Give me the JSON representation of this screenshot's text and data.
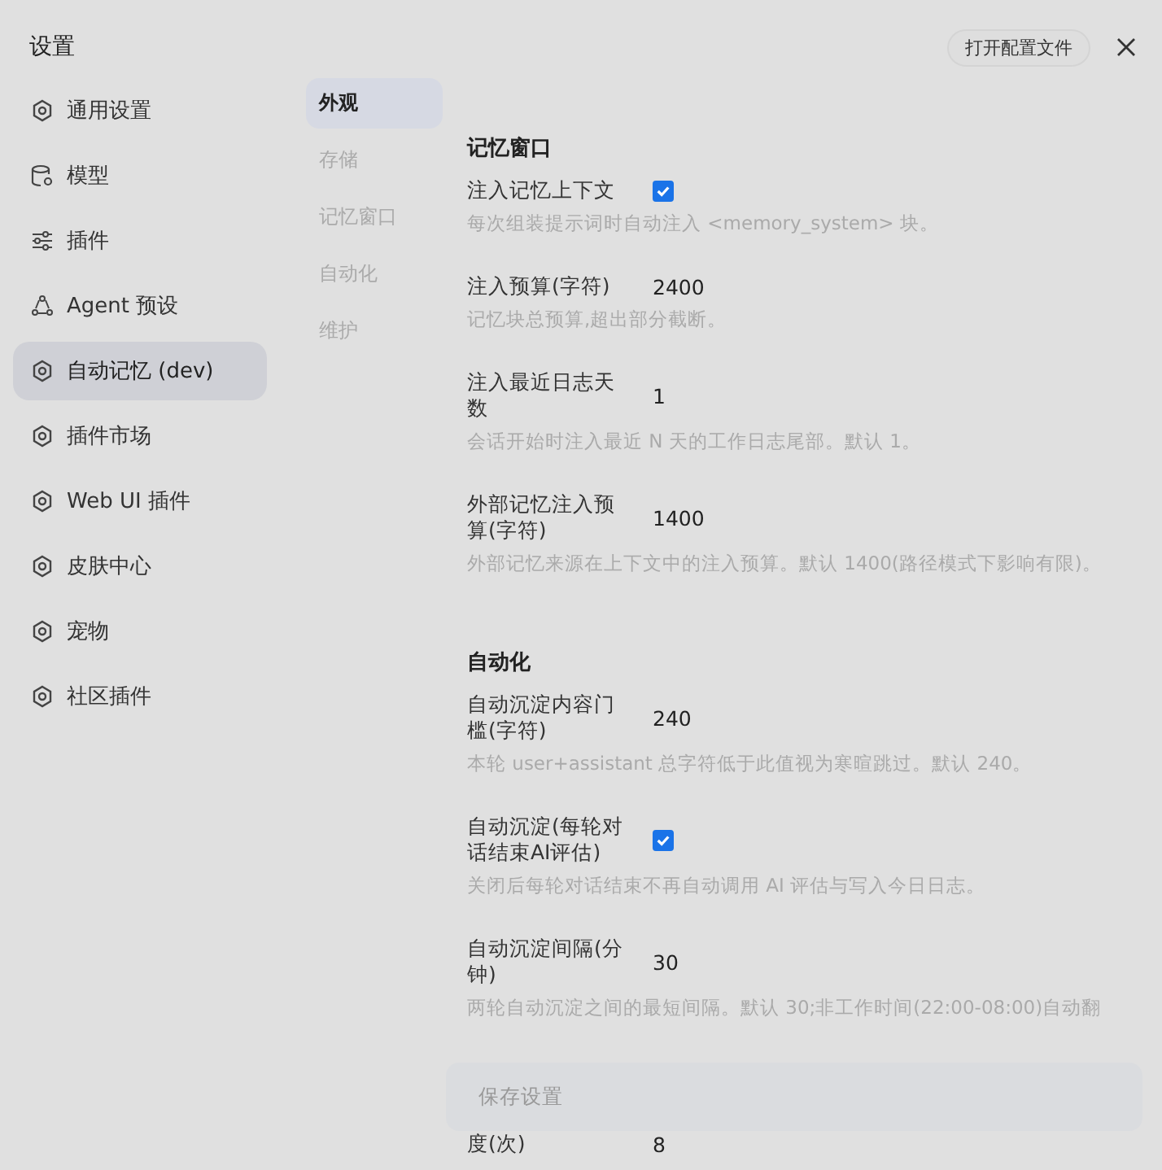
{
  "window": {
    "title": "设置",
    "open_config_button": "打开配置文件"
  },
  "sidebar": {
    "items": [
      {
        "label": "通用设置",
        "selected": false
      },
      {
        "label": "模型",
        "selected": false
      },
      {
        "label": "插件",
        "selected": false
      },
      {
        "label": "Agent 预设",
        "selected": false
      },
      {
        "label": "自动记忆 (dev)",
        "selected": true
      },
      {
        "label": "插件市场",
        "selected": false
      },
      {
        "label": "Web UI 插件",
        "selected": false
      },
      {
        "label": "皮肤中心",
        "selected": false
      },
      {
        "label": "宠物",
        "selected": false
      },
      {
        "label": "社区插件",
        "selected": false
      }
    ]
  },
  "subnav": [
    {
      "label": "外观",
      "selected": true
    },
    {
      "label": "存储",
      "selected": false
    },
    {
      "label": "记忆窗口",
      "selected": false
    },
    {
      "label": "自动化",
      "selected": false
    },
    {
      "label": "维护",
      "selected": false
    }
  ],
  "sections": [
    {
      "title": "记忆窗口",
      "fields": [
        {
          "kind": "checkbox",
          "label": "注入记忆上下文",
          "checked": true,
          "description": "每次组装提示词时自动注入 <memory_system> 块。"
        },
        {
          "kind": "number",
          "label": "注入预算(字符)",
          "value": "2400",
          "description": "记忆块总预算,超出部分截断。"
        },
        {
          "kind": "number",
          "label": "注入最近日志天数",
          "value": "1",
          "description": "会话开始时注入最近 N 天的工作日志尾部。默认 1。"
        },
        {
          "kind": "number",
          "label": "外部记忆注入预算(字符)",
          "value": "1400",
          "description": "外部记忆来源在上下文中的注入预算。默认 1400(路径模式下影响有限)。"
        }
      ]
    },
    {
      "title": "自动化",
      "fields": [
        {
          "kind": "number",
          "label": "自动沉淀内容门槛(字符)",
          "value": "240",
          "description": "本轮 user+assistant 总字符低于此值视为寒暄跳过。默认 240。"
        },
        {
          "kind": "checkbox",
          "label": "自动沉淀(每轮对话结束AI评估)",
          "checked": true,
          "description": "关闭后每轮对话结束不再自动调用 AI 评估与写入今日日志。"
        },
        {
          "kind": "number",
          "label": "自动沉淀间隔(分钟)",
          "value": "30",
          "description": "两轮自动沉淀之间的最短间隔。默认 30;非工作时间(22:00-08:00)自动翻"
        },
        {
          "kind": "number",
          "label": "度(次)",
          "value": "8"
        }
      ]
    }
  ],
  "save_button": "保存设置"
}
